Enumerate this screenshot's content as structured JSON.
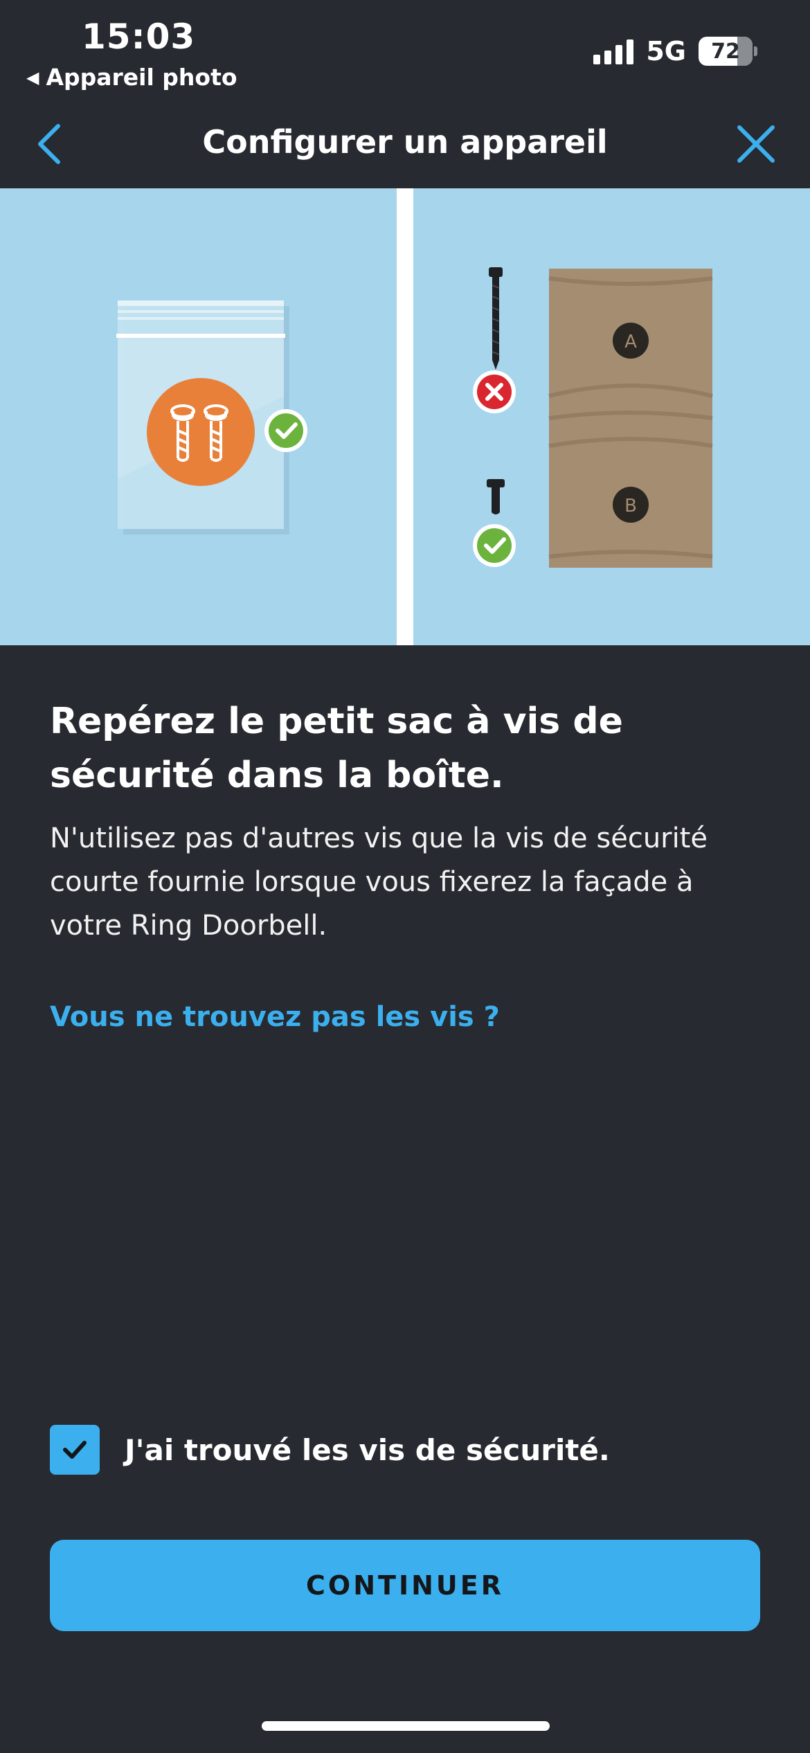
{
  "status_bar": {
    "time": "15:03",
    "back_app": "Appareil photo",
    "network": "5G",
    "battery": "72"
  },
  "nav": {
    "title": "Configurer un appareil",
    "back_icon": "chevron-left-icon",
    "close_icon": "close-icon"
  },
  "illustration": {
    "left_panel": {
      "icons": [
        "screw-bag",
        "security-screw-icon",
        "check-icon"
      ]
    },
    "right_panel": {
      "labels": {
        "a": "A",
        "b": "B"
      },
      "icons": [
        "long-screw",
        "x-icon",
        "short-screw",
        "check-icon",
        "foam-insert"
      ]
    }
  },
  "content": {
    "headline": "Repérez le petit sac à vis de sécurité dans la boîte.",
    "body": "N'utilisez pas d'autres vis que la vis de sécurité courte fournie lorsque vous fixerez la façade à votre Ring Doorbell.",
    "help_link": "Vous ne trouvez pas les vis ?"
  },
  "confirm": {
    "checked": true,
    "label": "J'ai trouvé les vis de sécurité."
  },
  "button": {
    "label": "CONTINUER"
  },
  "colors": {
    "background": "#272a30",
    "accent": "#3cb0ee",
    "panel": "#a7d5ec",
    "bag_circle": "#e8803a",
    "success": "#6cb33e",
    "error": "#d9262f",
    "foam": "#a58d72"
  }
}
